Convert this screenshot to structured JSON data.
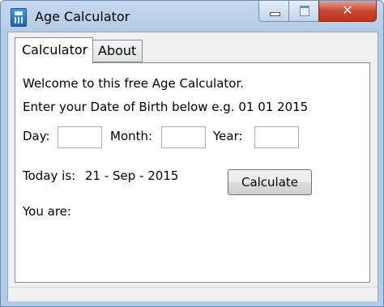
{
  "window": {
    "title": "Age Calculator",
    "close_glyph": "✕"
  },
  "tabs": [
    {
      "label": "Calculator",
      "selected": true
    },
    {
      "label": "About",
      "selected": false
    }
  ],
  "calculator": {
    "welcome_text": "Welcome to this free Age Calculator.",
    "instruction_text": "Enter your Date of Birth below e.g. 01 01 2015",
    "day_label": "Day:",
    "month_label": "Month:",
    "year_label": "Year:",
    "day_value": "",
    "month_value": "",
    "year_value": "",
    "today_label": "Today is:",
    "today_value": "21 - Sep - 2015",
    "calculate_label": "Calculate",
    "result_label": "You are:"
  },
  "icons": {
    "app": "calculator-icon",
    "minimize": "minimize-icon",
    "maximize": "maximize-icon",
    "close": "close-icon"
  }
}
